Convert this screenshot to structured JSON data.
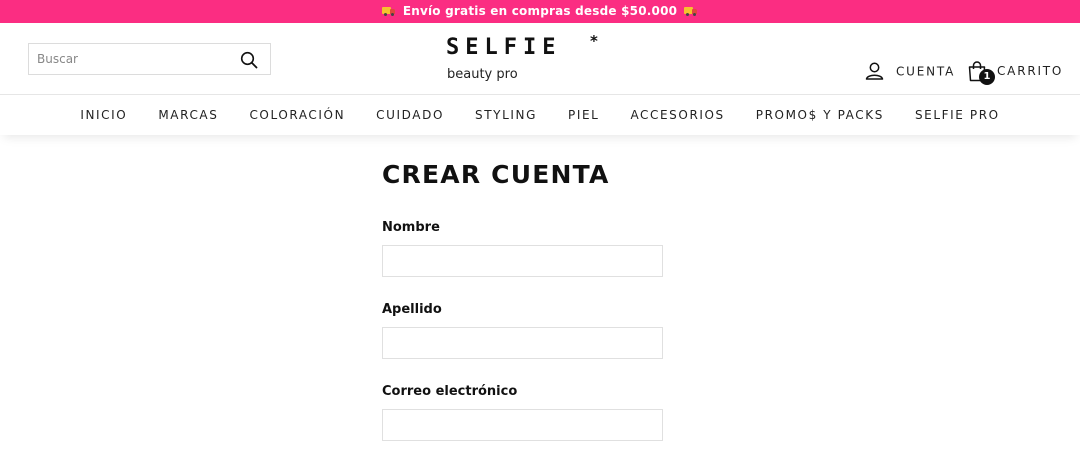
{
  "announcement": {
    "text": "Envío gratis en compras desde $50.000"
  },
  "header": {
    "search": {
      "placeholder": "Buscar"
    },
    "logo": {
      "word": "SELFIE",
      "star": "*",
      "sub": "beauty pro"
    },
    "account_label": "CUENTA",
    "cart": {
      "label": "CARRITO",
      "count": "1"
    }
  },
  "nav": {
    "items": [
      "INICIO",
      "MARCAS",
      "COLORACIÓN",
      "CUIDADO",
      "STYLING",
      "PIEL",
      "ACCESORIOS",
      "PROMO$ Y PACKS",
      "SELFIE PRO"
    ]
  },
  "form": {
    "title": "CREAR CUENTA",
    "fields": [
      {
        "label": "Nombre",
        "value": ""
      },
      {
        "label": "Apellido",
        "value": ""
      },
      {
        "label": "Correo electrónico",
        "value": ""
      }
    ]
  },
  "colors": {
    "announcement_bg": "#fb2d82",
    "text": "#111111"
  },
  "icons": [
    "truck-icon",
    "search-icon",
    "user-icon",
    "shopping-bag-icon"
  ]
}
